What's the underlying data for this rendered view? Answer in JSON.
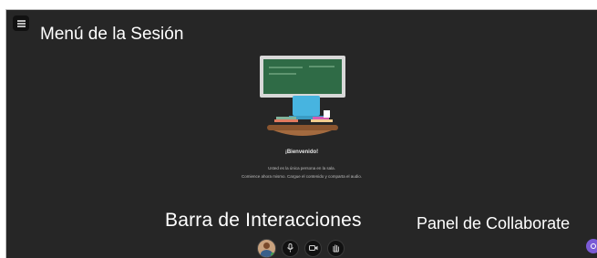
{
  "annotations": {
    "session_menu": "Menú de la Sesión",
    "interaction_bar": "Barra de Interacciones",
    "collaborate_panel": "Panel de Collaborate"
  },
  "welcome": {
    "title": "¡Bienvenido!",
    "line1": "Usted es la única persona en la sala.",
    "line2": "Comience ahora mismo. Cargue el contenido y comparta el audio."
  },
  "icons": {
    "menu": "menu-icon",
    "microphone": "microphone-icon",
    "camera": "camera-icon",
    "share_hand": "raise-hand-icon",
    "panel_toggle": "panel-toggle-icon"
  },
  "colors": {
    "background": "#262626",
    "accent": "#7b5bd6",
    "status_online": "#3ea34e"
  }
}
